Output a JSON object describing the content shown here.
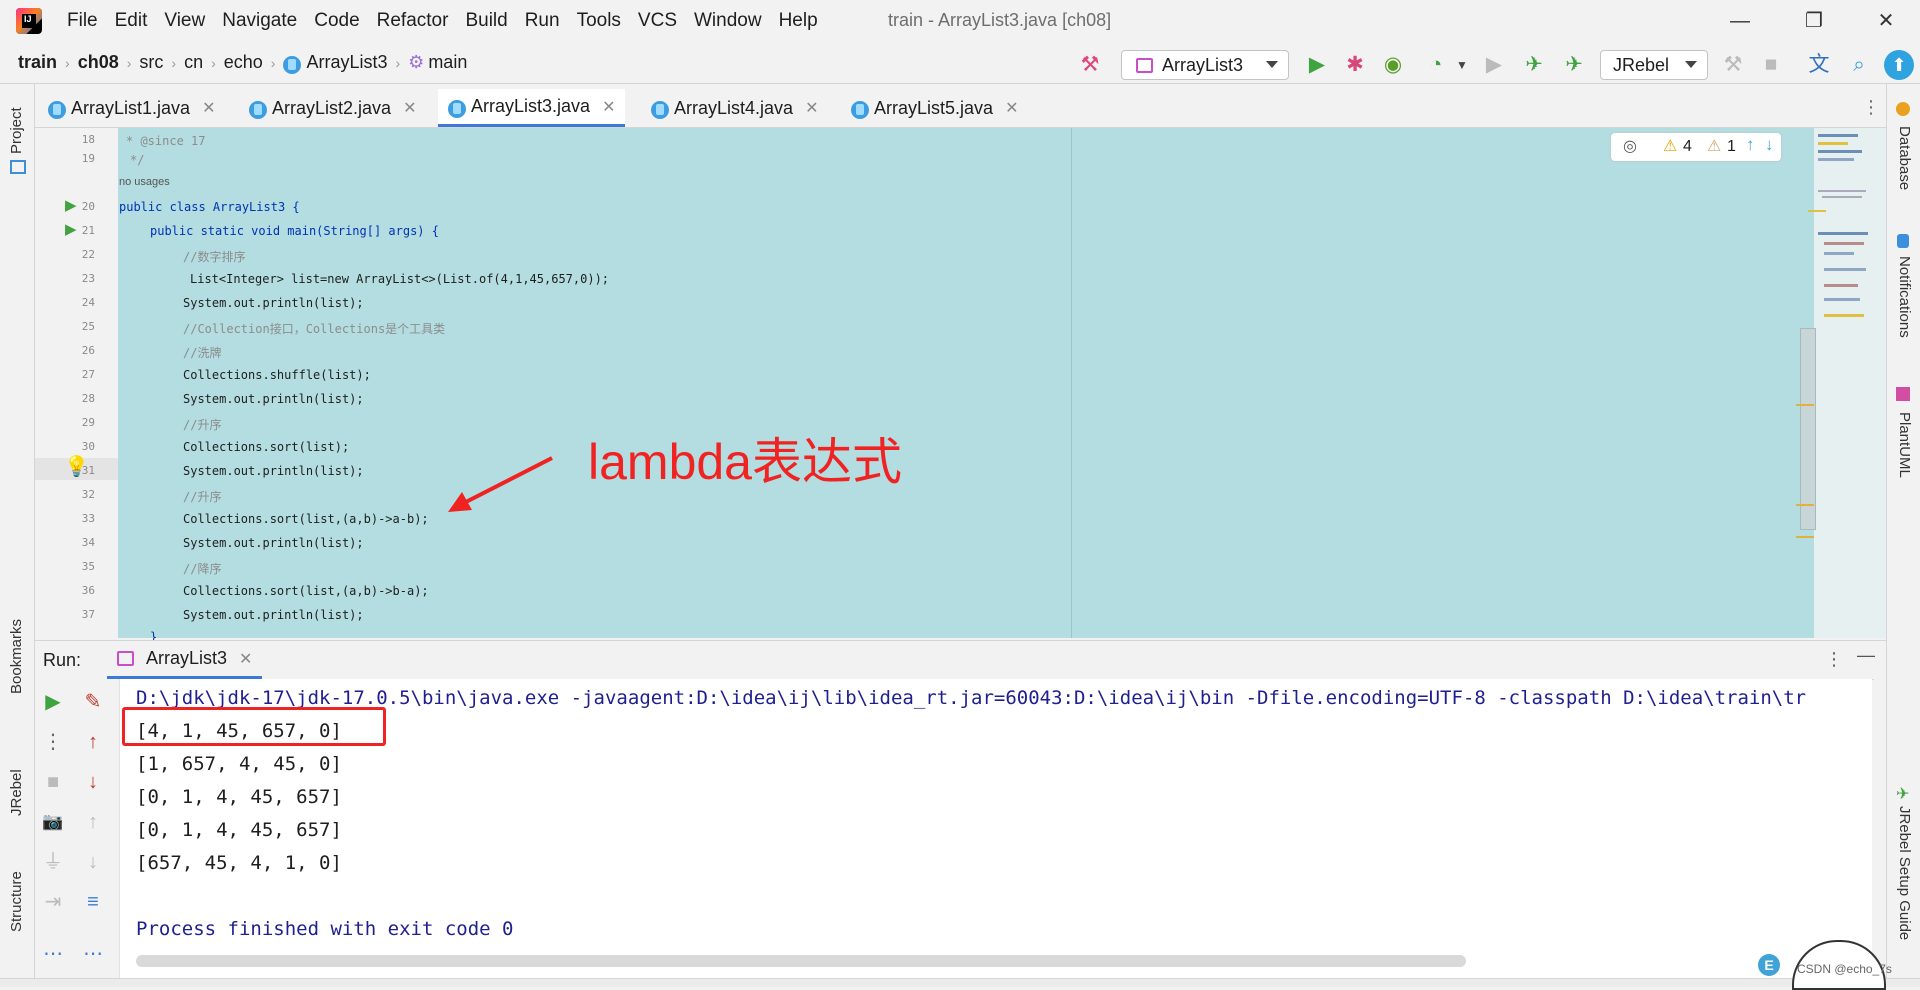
{
  "window": {
    "title": "train - ArrayList3.java [ch08]",
    "menu": [
      "File",
      "Edit",
      "View",
      "Navigate",
      "Code",
      "Refactor",
      "Build",
      "Run",
      "Tools",
      "VCS",
      "Window",
      "Help"
    ]
  },
  "breadcrumb": [
    "train",
    "ch08",
    "src",
    "cn",
    "echo",
    "ArrayList3",
    "main"
  ],
  "toolbar": {
    "run_config": "ArrayList3",
    "jrebel": "JRebel"
  },
  "left_strip": [
    "Project",
    "Bookmarks",
    "JRebel",
    "Structure"
  ],
  "right_strip": [
    "Database",
    "Notifications",
    "PlantUML",
    "JRebel Setup Guide"
  ],
  "tabs": [
    {
      "label": "ArrayList1.java",
      "active": false
    },
    {
      "label": "ArrayList2.java",
      "active": false
    },
    {
      "label": "ArrayList3.java",
      "active": true
    },
    {
      "label": "ArrayList4.java",
      "active": false
    },
    {
      "label": "ArrayList5.java",
      "active": false
    }
  ],
  "inspections": {
    "warnings": "4",
    "weak_warnings": "1"
  },
  "editor": {
    "usages_hint": "no usages",
    "line_numbers": [
      "18",
      "19",
      "20",
      "21",
      "22",
      "23",
      "24",
      "25",
      "26",
      "27",
      "28",
      "29",
      "30",
      "31",
      "32",
      "33",
      "34",
      "35",
      "36",
      "37"
    ],
    "lines": [
      "* @since 17",
      "*/",
      "public class ArrayList3 {",
      "public static void main(String[] args) {",
      "//数字排序",
      "List<Integer> list=new ArrayList<>(List.of(4,1,45,657,0));",
      "System.out.println(list);",
      "//Collection接口，Collections是个工具类",
      "//洗牌",
      "Collections.shuffle(list);",
      "System.out.println(list);",
      "//升序",
      "Collections.sort(list);",
      "System.out.println(list);",
      "//升序",
      "Collections.sort(list,(a,b)->a-b);",
      "System.out.println(list);",
      "//降序",
      "Collections.sort(list,(a,b)->b-a);",
      "System.out.println(list);"
    ]
  },
  "annotation": "lambda表达式",
  "run_panel": {
    "label": "Run:",
    "tab": "ArrayList3",
    "command": "D:\\jdk\\jdk-17\\jdk-17.0.5\\bin\\java.exe -javaagent:D:\\idea\\ij\\lib\\idea_rt.jar=60043:D:\\idea\\ij\\bin -Dfile.encoding=UTF-8 -classpath D:\\idea\\train\\tr",
    "output": [
      "[4, 1, 45, 657, 0]",
      "[1, 657, 4, 45, 0]",
      "[0, 1, 4, 45, 657]",
      "[0, 1, 4, 45, 657]",
      "[657, 45, 4, 1, 0]"
    ],
    "finished": "Process finished with exit code 0"
  },
  "watermark": "CSDN @echo_7s"
}
